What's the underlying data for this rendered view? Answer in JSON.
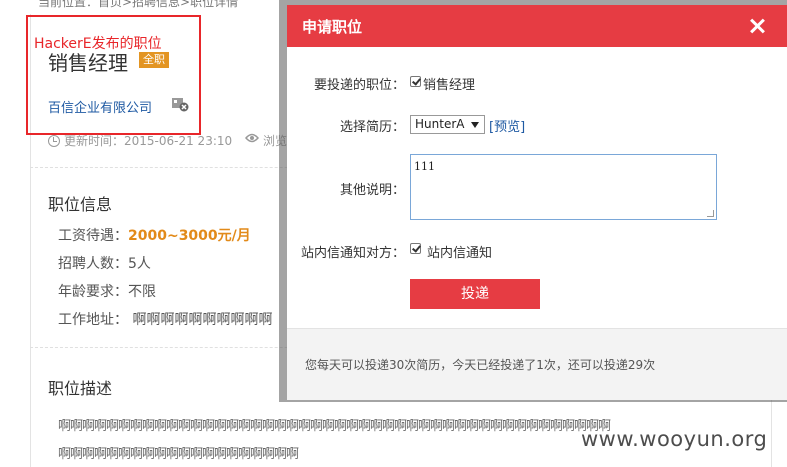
{
  "breadcrumb": "当前位置：首页>招聘信息>职位详情",
  "annotation": {
    "label": "HackerE发布的职位",
    "color": "#e8262a"
  },
  "job": {
    "title": "销售经理",
    "type_badge": "全职",
    "company": "百信企业有限公司",
    "updated": "更新时间：2015-06-21 23:10",
    "views_label": "浏览"
  },
  "info": {
    "heading": "职位信息",
    "salary_label": "工资待遇：",
    "salary_value": "2000~3000元/月",
    "headcount": "招聘人数：5人",
    "age": "年龄要求：不限",
    "address_label": "工作地址：",
    "address_value": "啊啊啊啊啊啊啊啊啊啊"
  },
  "description": {
    "heading": "职位描述",
    "lines": [
      "啊啊啊啊啊啊啊啊啊啊啊啊啊啊啊啊啊啊啊啊啊啊啊啊啊啊啊啊啊啊啊啊啊啊啊啊啊啊啊啊啊啊啊啊啊啊",
      "啊啊啊啊啊啊啊啊啊啊啊啊啊啊啊啊啊啊啊啊"
    ]
  },
  "dialog": {
    "title": "申请职位",
    "position_label": "要投递的职位：",
    "position_value": "销售经理",
    "resume_label": "选择简历：",
    "resume_selected": "HunterA",
    "preview_link": "[预览]",
    "note_label": "其他说明：",
    "note_value": "111",
    "notify_label": "站内信通知对方：",
    "notify_option": "站内信通知",
    "submit": "投递",
    "footer": "您每天可以投递30次简历，今天已经投递了1次，还可以投递29次"
  },
  "colors": {
    "accent": "#e63c43",
    "link": "#1f5aa3",
    "salary": "#e28a19",
    "badge": "#e39523"
  },
  "watermark": "www.wooyun.org"
}
